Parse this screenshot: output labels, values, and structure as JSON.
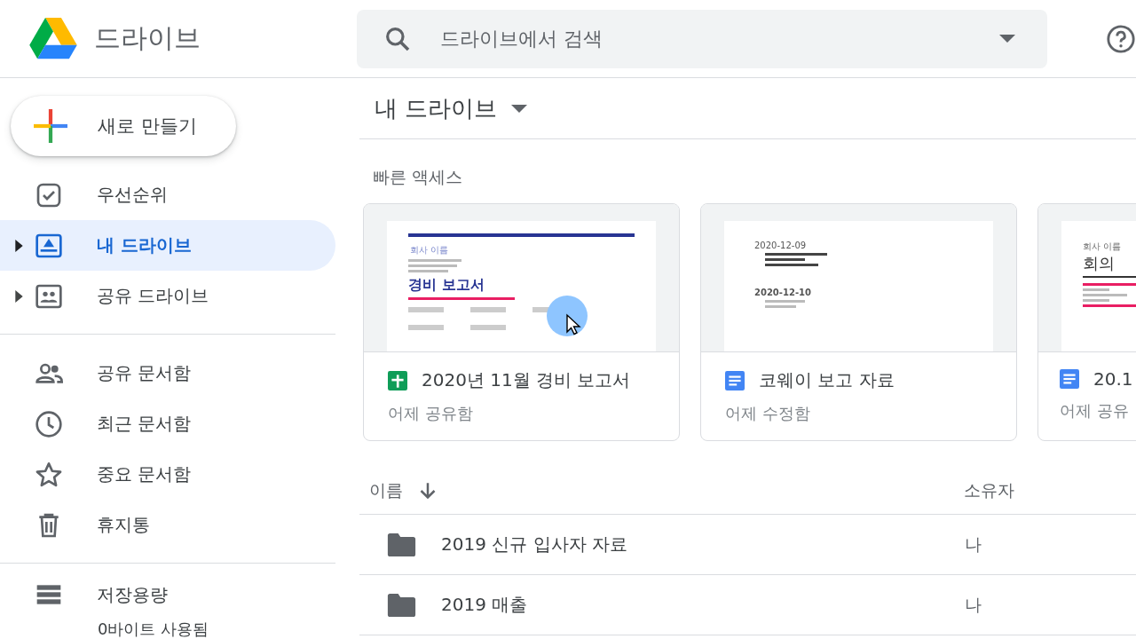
{
  "header": {
    "app_name": "드라이브",
    "search": {
      "placeholder": "드라이브에서 검색"
    }
  },
  "sidebar": {
    "new_button": "새로 만들기",
    "items": [
      {
        "label": "우선순위",
        "selected": false,
        "expandable": false
      },
      {
        "label": "내 드라이브",
        "selected": true,
        "expandable": true
      },
      {
        "label": "공유 드라이브",
        "selected": false,
        "expandable": true
      },
      {
        "label": "공유 문서함",
        "selected": false,
        "expandable": false
      },
      {
        "label": "최근 문서함",
        "selected": false,
        "expandable": false
      },
      {
        "label": "중요 문서함",
        "selected": false,
        "expandable": false
      },
      {
        "label": "휴지통",
        "selected": false,
        "expandable": false
      },
      {
        "label": "저장용량",
        "selected": false,
        "expandable": false
      }
    ],
    "storage_text": "0바이트 사용됨"
  },
  "main": {
    "title": "내 드라이브",
    "quick_access": {
      "heading": "빠른 액세스",
      "cards": [
        {
          "kind": "sheet",
          "name": "2020년 11월 경비 보고서",
          "subtitle": "어제 공유함",
          "preview": [
            "회사 이름",
            "경비 보고서"
          ]
        },
        {
          "kind": "doc",
          "name": "코웨이 보고 자료",
          "subtitle": "어제 수정함",
          "preview": [
            "2020-12-09",
            "2020-12-10"
          ]
        },
        {
          "kind": "doc",
          "name": "20.1",
          "subtitle": "어제 공유",
          "preview": [
            "회사 이름",
            "회의 "
          ]
        }
      ]
    },
    "table": {
      "columns": [
        "이름",
        "소유자"
      ],
      "rows": [
        {
          "name": "2019 신규 입사자 자료",
          "owner": "나"
        },
        {
          "name": "2019 매출",
          "owner": "나"
        }
      ]
    }
  }
}
